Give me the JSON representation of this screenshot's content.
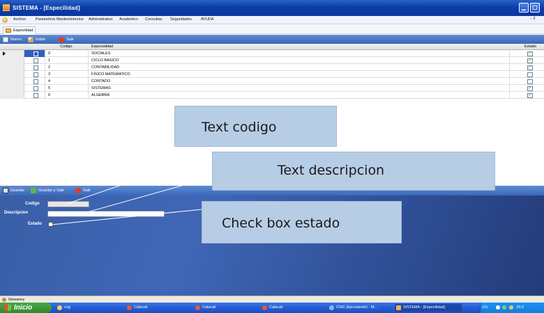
{
  "window": {
    "title": "SISTEMA - [Especilidad]"
  },
  "menu": {
    "items": [
      "Archivo",
      "Parametros Mantenimientos",
      "Administrativo",
      "Academico",
      "Consultas",
      "Seguridades",
      "AYUDA"
    ],
    "restore_glyph": "- ₫"
  },
  "tab": {
    "label": "Especilidad"
  },
  "toolbar": {
    "new_label": "Nuevo",
    "edit_label": "Editar",
    "exit_label": "Salir"
  },
  "grid": {
    "columns": {
      "code": "Codigo",
      "specialty": "Especialidad",
      "state": "Estado"
    },
    "rows": [
      {
        "code": "0",
        "name": "SOCIALES",
        "estado": true,
        "selected": true
      },
      {
        "code": "1",
        "name": "CICLO BASICO",
        "estado": true
      },
      {
        "code": "2",
        "name": "CONTABILIDAD",
        "estado": true
      },
      {
        "code": "3",
        "name": "FISICO MATEMATICO",
        "estado": false
      },
      {
        "code": "4",
        "name": "CONTADO",
        "estado": false
      },
      {
        "code": "5",
        "name": "SISTEMAS",
        "estado": true
      },
      {
        "code": "6",
        "name": "ALGEBRA",
        "estado": true
      }
    ]
  },
  "edit_toolbar": {
    "save_label": "Guardar",
    "save_exit_label": "Guardar y Salir",
    "exit_label": "Salir"
  },
  "form": {
    "codigo_label": "Codigo",
    "codigo_value": "",
    "descripcion_label": "Descripcion",
    "descripcion_value": "",
    "estado_label": "Estado"
  },
  "callouts": {
    "codigo": "Text  codigo",
    "descripcion": "Text  descripcion",
    "estado": "Check box estado"
  },
  "status": {
    "user": "Giovanny"
  },
  "taskbar": {
    "start_label": "Inicio",
    "tasks": [
      "cng",
      "Calacali",
      "Calacali",
      "Calacali",
      "CNG (Ejecutando) - M...",
      "SISTEMA - [Especilidad]"
    ],
    "lang": "ES",
    "clock": "20:2"
  },
  "colors": {
    "title_blue": "#0a36a0",
    "form_blue": "#3f67b6",
    "callout": "#b7cde6"
  }
}
